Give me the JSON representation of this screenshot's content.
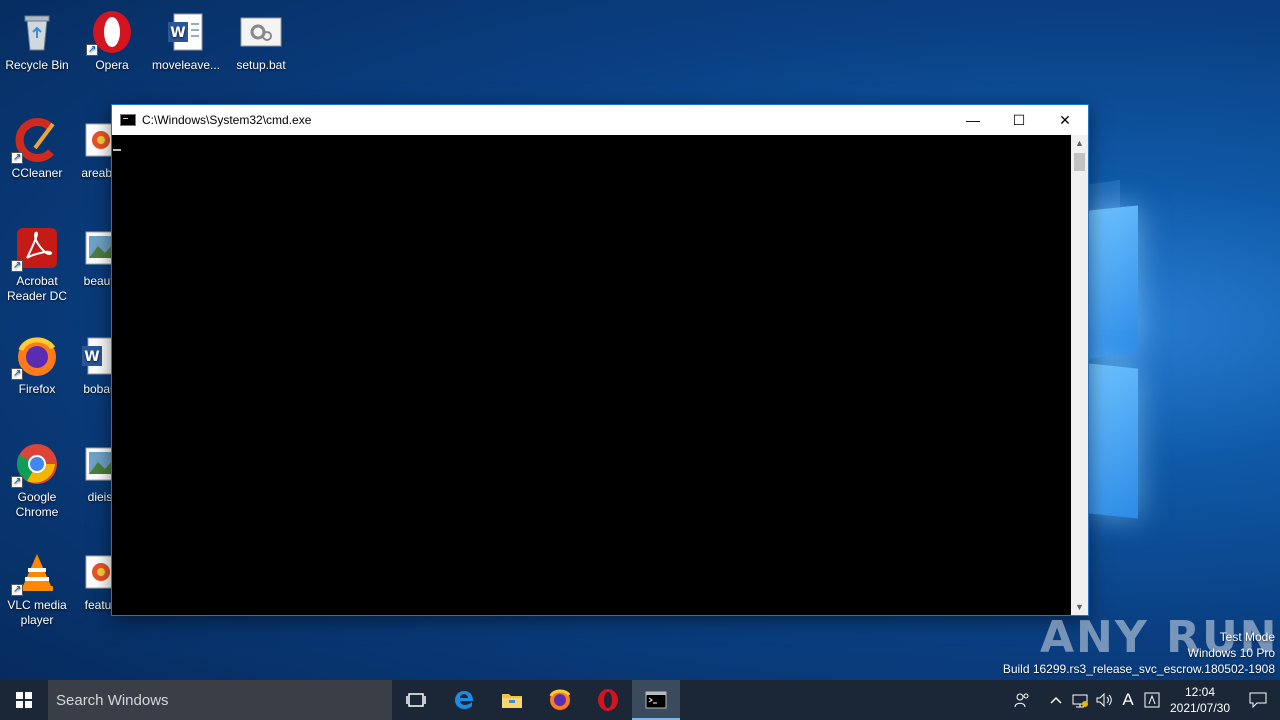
{
  "desktop": {
    "icons": [
      {
        "label": "Recycle Bin",
        "icon": "recycle-bin-icon"
      },
      {
        "label": "Opera",
        "icon": "opera-icon"
      },
      {
        "label": "moveleave...",
        "icon": "word-document-icon"
      },
      {
        "label": "setup.bat",
        "icon": "batch-file-icon"
      },
      {
        "label": "CCleaner",
        "icon": "ccleaner-icon"
      },
      {
        "label": "areabu",
        "icon": "image-file-icon"
      },
      {
        "label": "Acrobat Reader DC",
        "icon": "acrobat-icon"
      },
      {
        "label": "beauti",
        "icon": "image-file-icon"
      },
      {
        "label": "Firefox",
        "icon": "firefox-icon"
      },
      {
        "label": "bobau",
        "icon": "word-document-icon"
      },
      {
        "label": "Google Chrome",
        "icon": "chrome-icon"
      },
      {
        "label": "dieis",
        "icon": "image-file-icon"
      },
      {
        "label": "VLC media player",
        "icon": "vlc-icon"
      },
      {
        "label": "featur",
        "icon": "image-file-icon"
      }
    ]
  },
  "window": {
    "title": "C:\\Windows\\System32\\cmd.exe",
    "controls": {
      "minimize": "—",
      "maximize": "☐",
      "close": "✕"
    }
  },
  "watermark": {
    "brand": "ANY RUN",
    "line1": "Test Mode",
    "line2": "Windows 10 Pro",
    "line3": "Build 16299.rs3_release_svc_escrow.180502-1908"
  },
  "taskbar": {
    "search_placeholder": "Search Windows",
    "apps": [
      "task-view",
      "edge",
      "file-explorer",
      "firefox",
      "opera",
      "cmd"
    ],
    "tray": {
      "language": "A",
      "time": "12:04",
      "date": "2021/07/30"
    }
  },
  "colors": {
    "taskbar": "#1b2736",
    "search_bg": "#3a3f47",
    "window_border": "#1e74d0",
    "console_bg": "#000000",
    "accent": "#76b9ed"
  }
}
